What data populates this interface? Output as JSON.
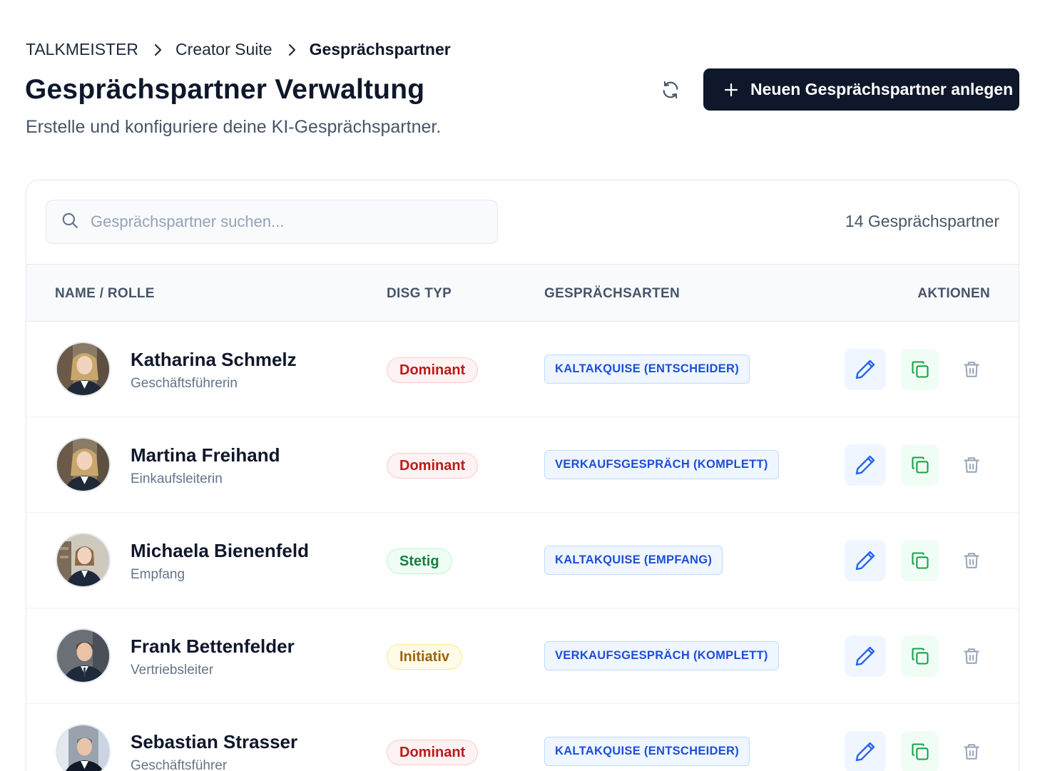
{
  "breadcrumb": {
    "items": [
      "TALKMEISTER",
      "Creator Suite",
      "Gesprächspartner"
    ]
  },
  "header": {
    "title": "Gesprächspartner Verwaltung",
    "subtitle": "Erstelle und konfiguriere deine KI-Gesprächspartner.",
    "create_label": "Neuen Gesprächspartner anlegen"
  },
  "search": {
    "placeholder": "Gesprächspartner suchen...",
    "value": ""
  },
  "count_label": "14 Gesprächspartner",
  "table": {
    "headers": [
      "NAME / ROLLE",
      "DISG TYP",
      "GESPRÄCHSARTEN",
      "AKTIONEN"
    ],
    "rows": [
      {
        "name": "Katharina Schmelz",
        "role": "Geschäftsführerin",
        "disg": "Dominant",
        "conversation": "KALTAKQUISE (ENTSCHEIDER)"
      },
      {
        "name": "Martina Freihand",
        "role": "Einkaufsleiterin",
        "disg": "Dominant",
        "conversation": "VERKAUFSGESPRÄCH (KOMPLETT)"
      },
      {
        "name": "Michaela Bienenfeld",
        "role": "Empfang",
        "disg": "Stetig",
        "conversation": "KALTAKQUISE (EMPFANG)"
      },
      {
        "name": "Frank Bettenfelder",
        "role": "Vertriebsleiter",
        "disg": "Initiativ",
        "conversation": "VERKAUFSGESPRÄCH (KOMPLETT)"
      },
      {
        "name": "Sebastian Strasser",
        "role": "Geschäftsführer",
        "disg": "Dominant",
        "conversation": "KALTAKQUISE (ENTSCHEIDER)"
      }
    ]
  },
  "icons": {
    "breadcrumb_separator": "chevron-right-icon",
    "refresh": "refresh-icon",
    "create": "plus-icon",
    "search": "search-icon",
    "edit": "pencil-icon",
    "copy": "copy-icon",
    "delete": "trash-icon"
  },
  "colors": {
    "primary": "#0f172a",
    "dominant": "#b91c1c",
    "stetig": "#15803d",
    "initiativ": "#a16207",
    "tag_text": "#1d4ed8",
    "edit_icon": "#2563eb",
    "copy_icon": "#16a34a"
  }
}
